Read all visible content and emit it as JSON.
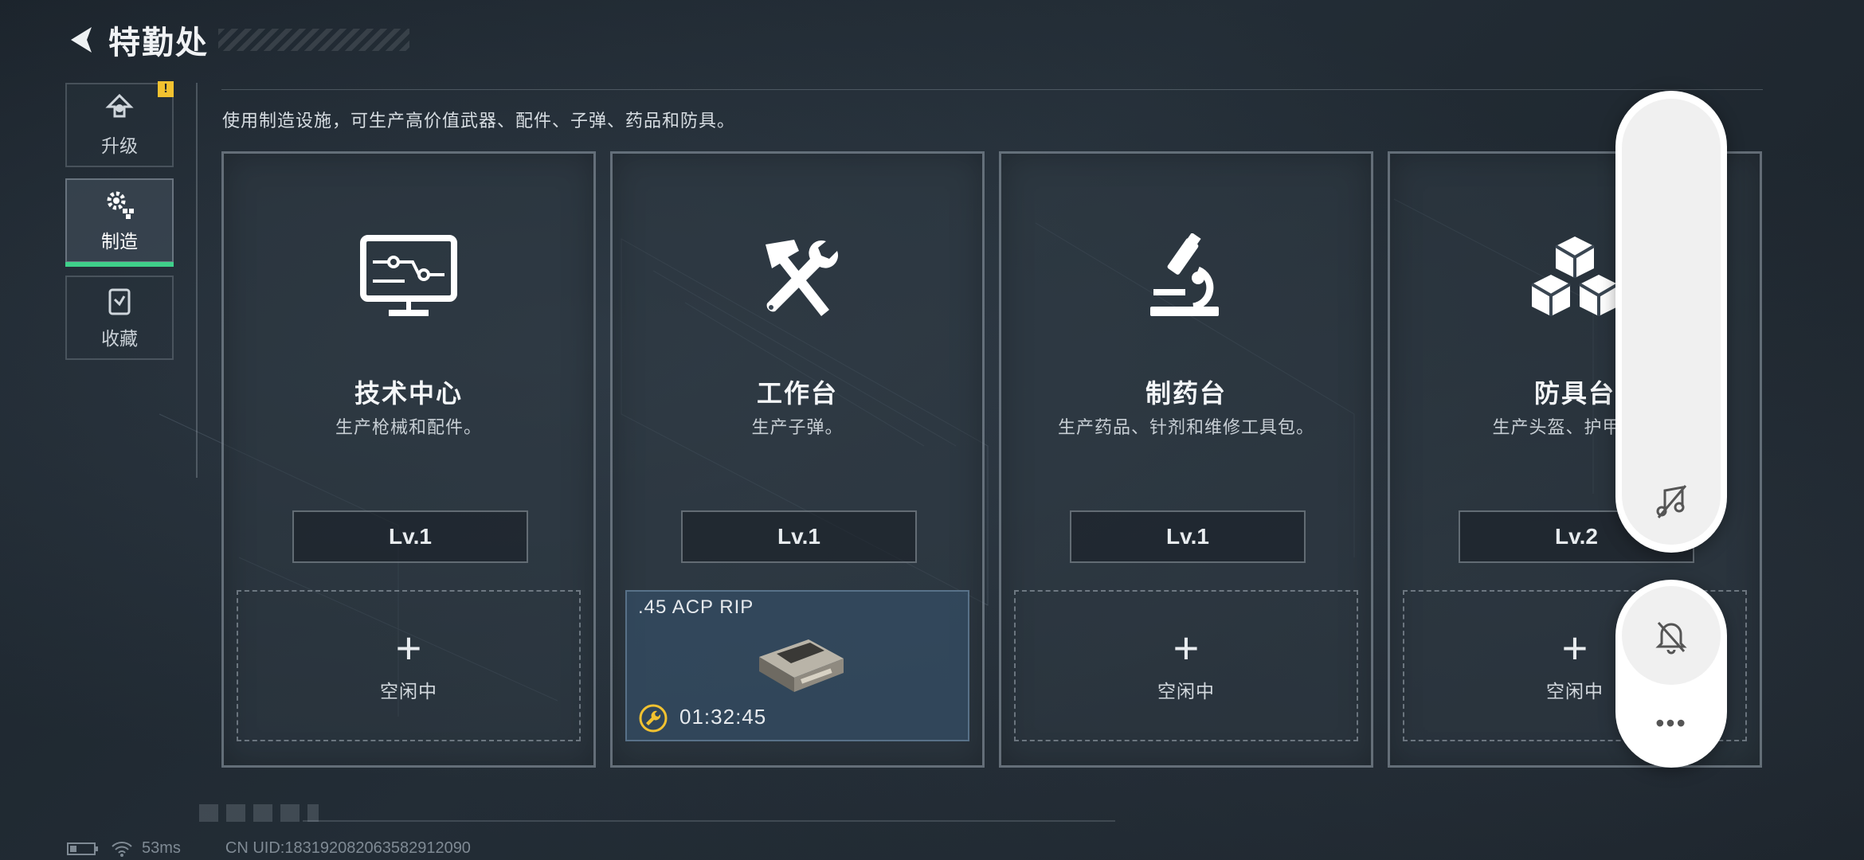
{
  "header": {
    "title": "特勤处"
  },
  "sidebar": {
    "items": [
      {
        "label": "升级",
        "icon": "upgrade-icon",
        "alert": "!"
      },
      {
        "label": "制造",
        "icon": "gear-icon"
      },
      {
        "label": "收藏",
        "icon": "collection-icon"
      }
    ]
  },
  "main": {
    "description": "使用制造设施，可生产高价值武器、配件、子弹、药品和防具。",
    "cards": [
      {
        "name": "技术中心",
        "desc": "生产枪械和配件。",
        "level": "Lv.1",
        "icon": "monitor-circuit-icon",
        "slot": {
          "plus": "+",
          "status": "空闲中"
        }
      },
      {
        "name": "工作台",
        "desc": "生产子弹。",
        "level": "Lv.1",
        "icon": "hammer-wrench-icon",
        "slot": {
          "item": ".45 ACP RIP",
          "timer": "01:32:45"
        }
      },
      {
        "name": "制药台",
        "desc": "生产药品、针剂和维修工具包。",
        "level": "Lv.1",
        "icon": "microscope-icon",
        "slot": {
          "plus": "+",
          "status": "空闲中"
        }
      },
      {
        "name": "防具台",
        "desc": "生产头盔、护甲、胸",
        "level": "Lv.2",
        "icon": "cubes-icon",
        "slot": {
          "plus": "+",
          "status": "空闲中"
        }
      }
    ]
  },
  "overlay": {
    "more": "•••"
  },
  "status_bar": {
    "ping": "53ms",
    "uid": "CN UID:1831920820635829​12090"
  },
  "colors": {
    "accent": "#3fd08a",
    "alert": "#f2c230",
    "busy_slot": "#344e66"
  }
}
